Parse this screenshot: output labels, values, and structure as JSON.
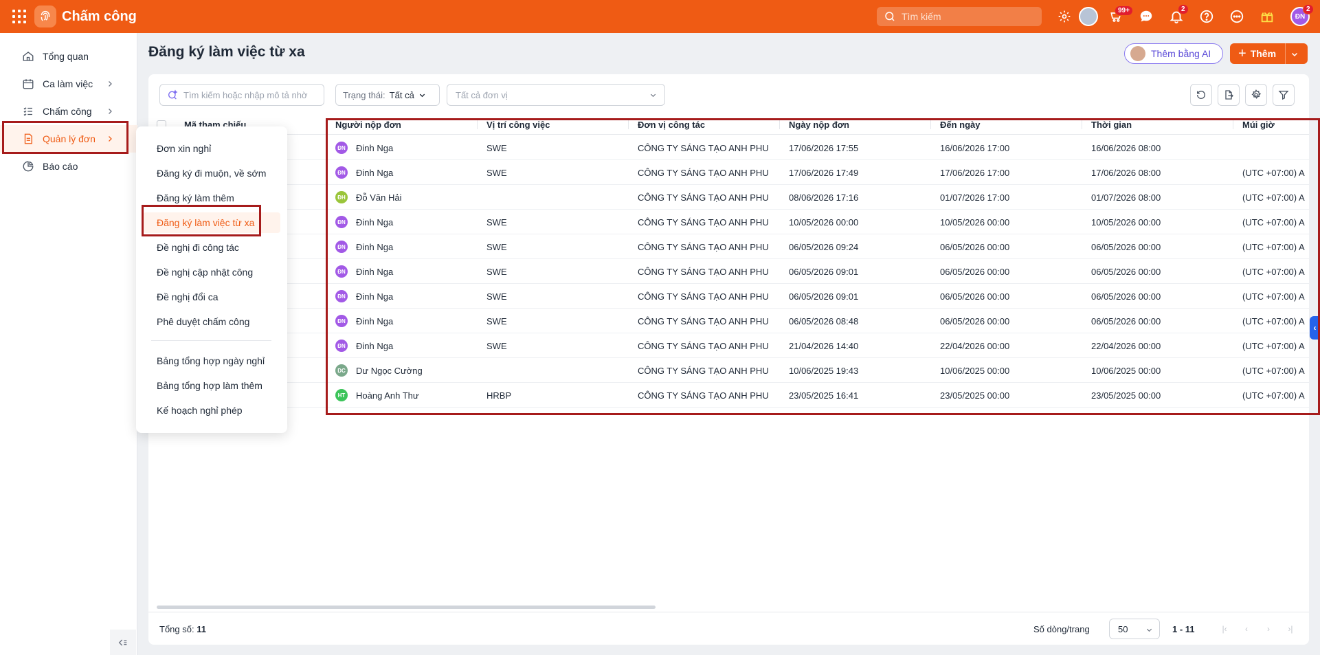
{
  "topbar": {
    "app_title": "Chấm công",
    "search_placeholder": "Tìm kiếm",
    "shopping_badge": "99+",
    "notification_badge": "2",
    "user_initials": "ĐN",
    "user_badge": "2"
  },
  "sidebar": {
    "items": [
      {
        "label": "Tổng quan",
        "icon": "home-icon"
      },
      {
        "label": "Ca làm việc",
        "icon": "calendar-icon"
      },
      {
        "label": "Chấm công",
        "icon": "checklist-icon"
      },
      {
        "label": "Quản lý đơn",
        "icon": "document-icon"
      },
      {
        "label": "Báo cáo",
        "icon": "pie-chart-icon"
      }
    ]
  },
  "submenu": {
    "items": [
      "Đơn xin nghỉ",
      "Đăng ký đi muộn, về sớm",
      "Đăng ký làm thêm",
      "Đăng ký làm việc từ xa",
      "Đề nghị đi công tác",
      "Đề nghị cập nhật công",
      "Đề nghị đổi ca",
      "Phê duyệt chấm công",
      "Bảng tổng hợp ngày nghỉ",
      "Bảng tổng hợp làm thêm",
      "Kế hoạch nghỉ phép"
    ]
  },
  "page": {
    "title": "Đăng ký làm việc từ xa",
    "ai_button": "Thêm bằng AI",
    "add_button": "Thêm"
  },
  "filters": {
    "search_placeholder": "Tìm kiếm hoặc nhập mô tả nhờ",
    "status_label": "Trạng thái:",
    "status_value": "Tất cả",
    "unit_placeholder": "Tất cả đơn vị"
  },
  "table": {
    "hidden_header": "Mã tham chiếu",
    "columns": [
      "Người nộp đơn",
      "Vị trí công việc",
      "Đơn vị công tác",
      "Ngày nộp đơn",
      "Đến ngày",
      "Thời gian",
      "Múi giờ"
    ],
    "rows": [
      {
        "initials": "ĐN",
        "color": "#a259e6",
        "name": "Đinh Nga",
        "position": "SWE",
        "unit": "CÔNG TY SÁNG TẠO ANH PHU",
        "submitted": "17/06/2026 17:55",
        "to_date": "16/06/2026 17:00",
        "time": "16/06/2026 08:00",
        "timezone": ""
      },
      {
        "initials": "ĐN",
        "color": "#a259e6",
        "name": "Đinh Nga",
        "position": "SWE",
        "unit": "CÔNG TY SÁNG TẠO ANH PHU",
        "submitted": "17/06/2026 17:49",
        "to_date": "17/06/2026 17:00",
        "time": "17/06/2026 08:00",
        "timezone": "(UTC +07:00) A"
      },
      {
        "initials": "ĐH",
        "color": "#9ac53a",
        "name": "Đỗ Văn Hải",
        "position": "",
        "unit": "CÔNG TY SÁNG TẠO ANH PHU",
        "submitted": "08/06/2026 17:16",
        "to_date": "01/07/2026 17:00",
        "time": "01/07/2026 08:00",
        "timezone": "(UTC +07:00) A"
      },
      {
        "initials": "ĐN",
        "color": "#a259e6",
        "name": "Đinh Nga",
        "position": "SWE",
        "unit": "CÔNG TY SÁNG TẠO ANH PHU",
        "submitted": "10/05/2026 00:00",
        "to_date": "10/05/2026 00:00",
        "time": "10/05/2026 00:00",
        "timezone": "(UTC +07:00) A"
      },
      {
        "initials": "ĐN",
        "color": "#a259e6",
        "name": "Đinh Nga",
        "position": "SWE",
        "unit": "CÔNG TY SÁNG TẠO ANH PHU",
        "submitted": "06/05/2026 09:24",
        "to_date": "06/05/2026 00:00",
        "time": "06/05/2026 00:00",
        "timezone": "(UTC +07:00) A"
      },
      {
        "initials": "ĐN",
        "color": "#a259e6",
        "name": "Đinh Nga",
        "position": "SWE",
        "unit": "CÔNG TY SÁNG TẠO ANH PHU",
        "submitted": "06/05/2026 09:01",
        "to_date": "06/05/2026 00:00",
        "time": "06/05/2026 00:00",
        "timezone": "(UTC +07:00) A"
      },
      {
        "initials": "ĐN",
        "color": "#a259e6",
        "name": "Đinh Nga",
        "position": "SWE",
        "unit": "CÔNG TY SÁNG TẠO ANH PHU",
        "submitted": "06/05/2026 09:01",
        "to_date": "06/05/2026 00:00",
        "time": "06/05/2026 00:00",
        "timezone": "(UTC +07:00) A"
      },
      {
        "initials": "ĐN",
        "color": "#a259e6",
        "name": "Đinh Nga",
        "position": "SWE",
        "unit": "CÔNG TY SÁNG TẠO ANH PHU",
        "submitted": "06/05/2026 08:48",
        "to_date": "06/05/2026 00:00",
        "time": "06/05/2026 00:00",
        "timezone": "(UTC +07:00) A"
      },
      {
        "initials": "ĐN",
        "color": "#a259e6",
        "name": "Đinh Nga",
        "position": "SWE",
        "unit": "CÔNG TY SÁNG TẠO ANH PHU",
        "submitted": "21/04/2026 14:40",
        "to_date": "22/04/2026 00:00",
        "time": "22/04/2026 00:00",
        "timezone": "(UTC +07:00) A"
      },
      {
        "initials": "DC",
        "color": "#7aa88a",
        "name": "Dư Ngọc Cường",
        "position": "",
        "unit": "CÔNG TY SÁNG TẠO ANH PHU",
        "submitted": "10/06/2025 19:43",
        "to_date": "10/06/2025 00:00",
        "time": "10/06/2025 00:00",
        "timezone": "(UTC +07:00) A"
      },
      {
        "initials": "HT",
        "color": "#3cc45a",
        "name": "Hoàng Anh Thư",
        "position": "HRBP",
        "unit": "CÔNG TY SÁNG TẠO ANH PHU",
        "submitted": "23/05/2025 16:41",
        "to_date": "23/05/2025 00:00",
        "time": "23/05/2025 00:00",
        "timezone": "(UTC +07:00) A"
      }
    ]
  },
  "footer": {
    "total_label": "Tổng số:",
    "total_value": "11",
    "rows_per_page_label": "Số dòng/trang",
    "rows_per_page_value": "50",
    "range": "1 - 11"
  },
  "colors": {
    "brand": "#ef5b14",
    "annotation": "#a61b1b"
  }
}
